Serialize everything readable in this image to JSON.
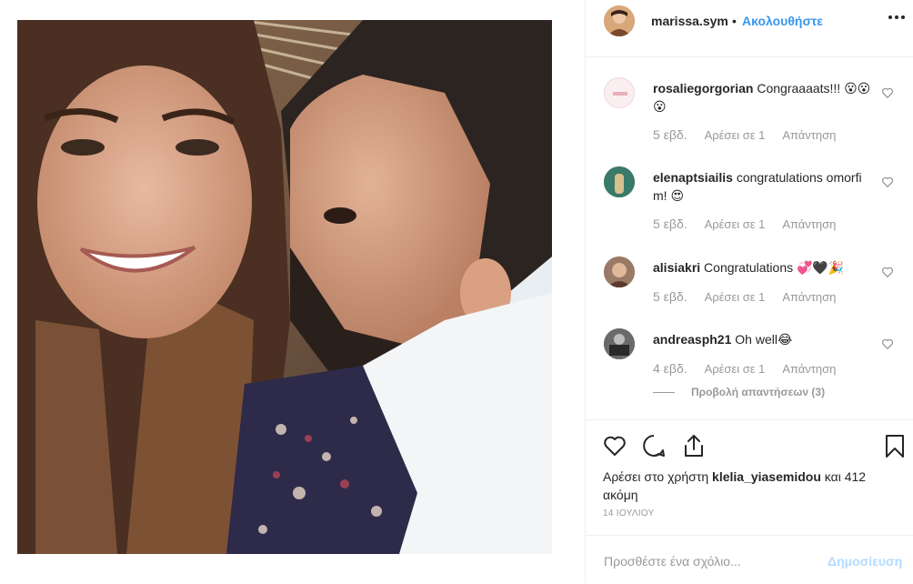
{
  "post": {
    "author": "marissa.sym",
    "separator": "•",
    "follow_label": "Ακολουθήστε"
  },
  "comments": [
    {
      "username": "rosaliegorgorian",
      "text": "Congraaaats!!! 😮😮😮",
      "time": "5 εβδ.",
      "likes": "Αρέσει σε 1",
      "reply": "Απάντηση"
    },
    {
      "username": "elenaptsiailis",
      "text": "congratulations omorfi m! 😍",
      "time": "5 εβδ.",
      "likes": "Αρέσει σε 1",
      "reply": "Απάντηση"
    },
    {
      "username": "alisiakri",
      "text": "Congratulations 💞🖤🎉",
      "time": "5 εβδ.",
      "likes": "Αρέσει σε 1",
      "reply": "Απάντηση"
    },
    {
      "username": "andreasph21",
      "text": "Oh well😂",
      "time": "4 εβδ.",
      "likes": "Αρέσει σε 1",
      "reply": "Απάντηση"
    }
  ],
  "view_replies": "Προβολή απαντήσεων (3)",
  "likes_line": {
    "prefix": "Αρέσει στο χρήστη",
    "user": "klelia_yiasemidou",
    "suffix": "και 412 ακόμη"
  },
  "date": "14 ΙΟΥΛΙΟΥ",
  "add_comment": {
    "placeholder": "Προσθέστε ένα σχόλιο...",
    "post_label": "Δημοσίευση"
  },
  "icons": {
    "more": "more-horizontal-icon",
    "heart": "heart-icon",
    "comment": "comment-bubble-icon",
    "share": "share-icon",
    "bookmark": "bookmark-icon"
  },
  "colors": {
    "link_blue": "#3897f0",
    "muted": "#999999",
    "post_disabled": "#b3dbff",
    "border": "#efefef"
  }
}
